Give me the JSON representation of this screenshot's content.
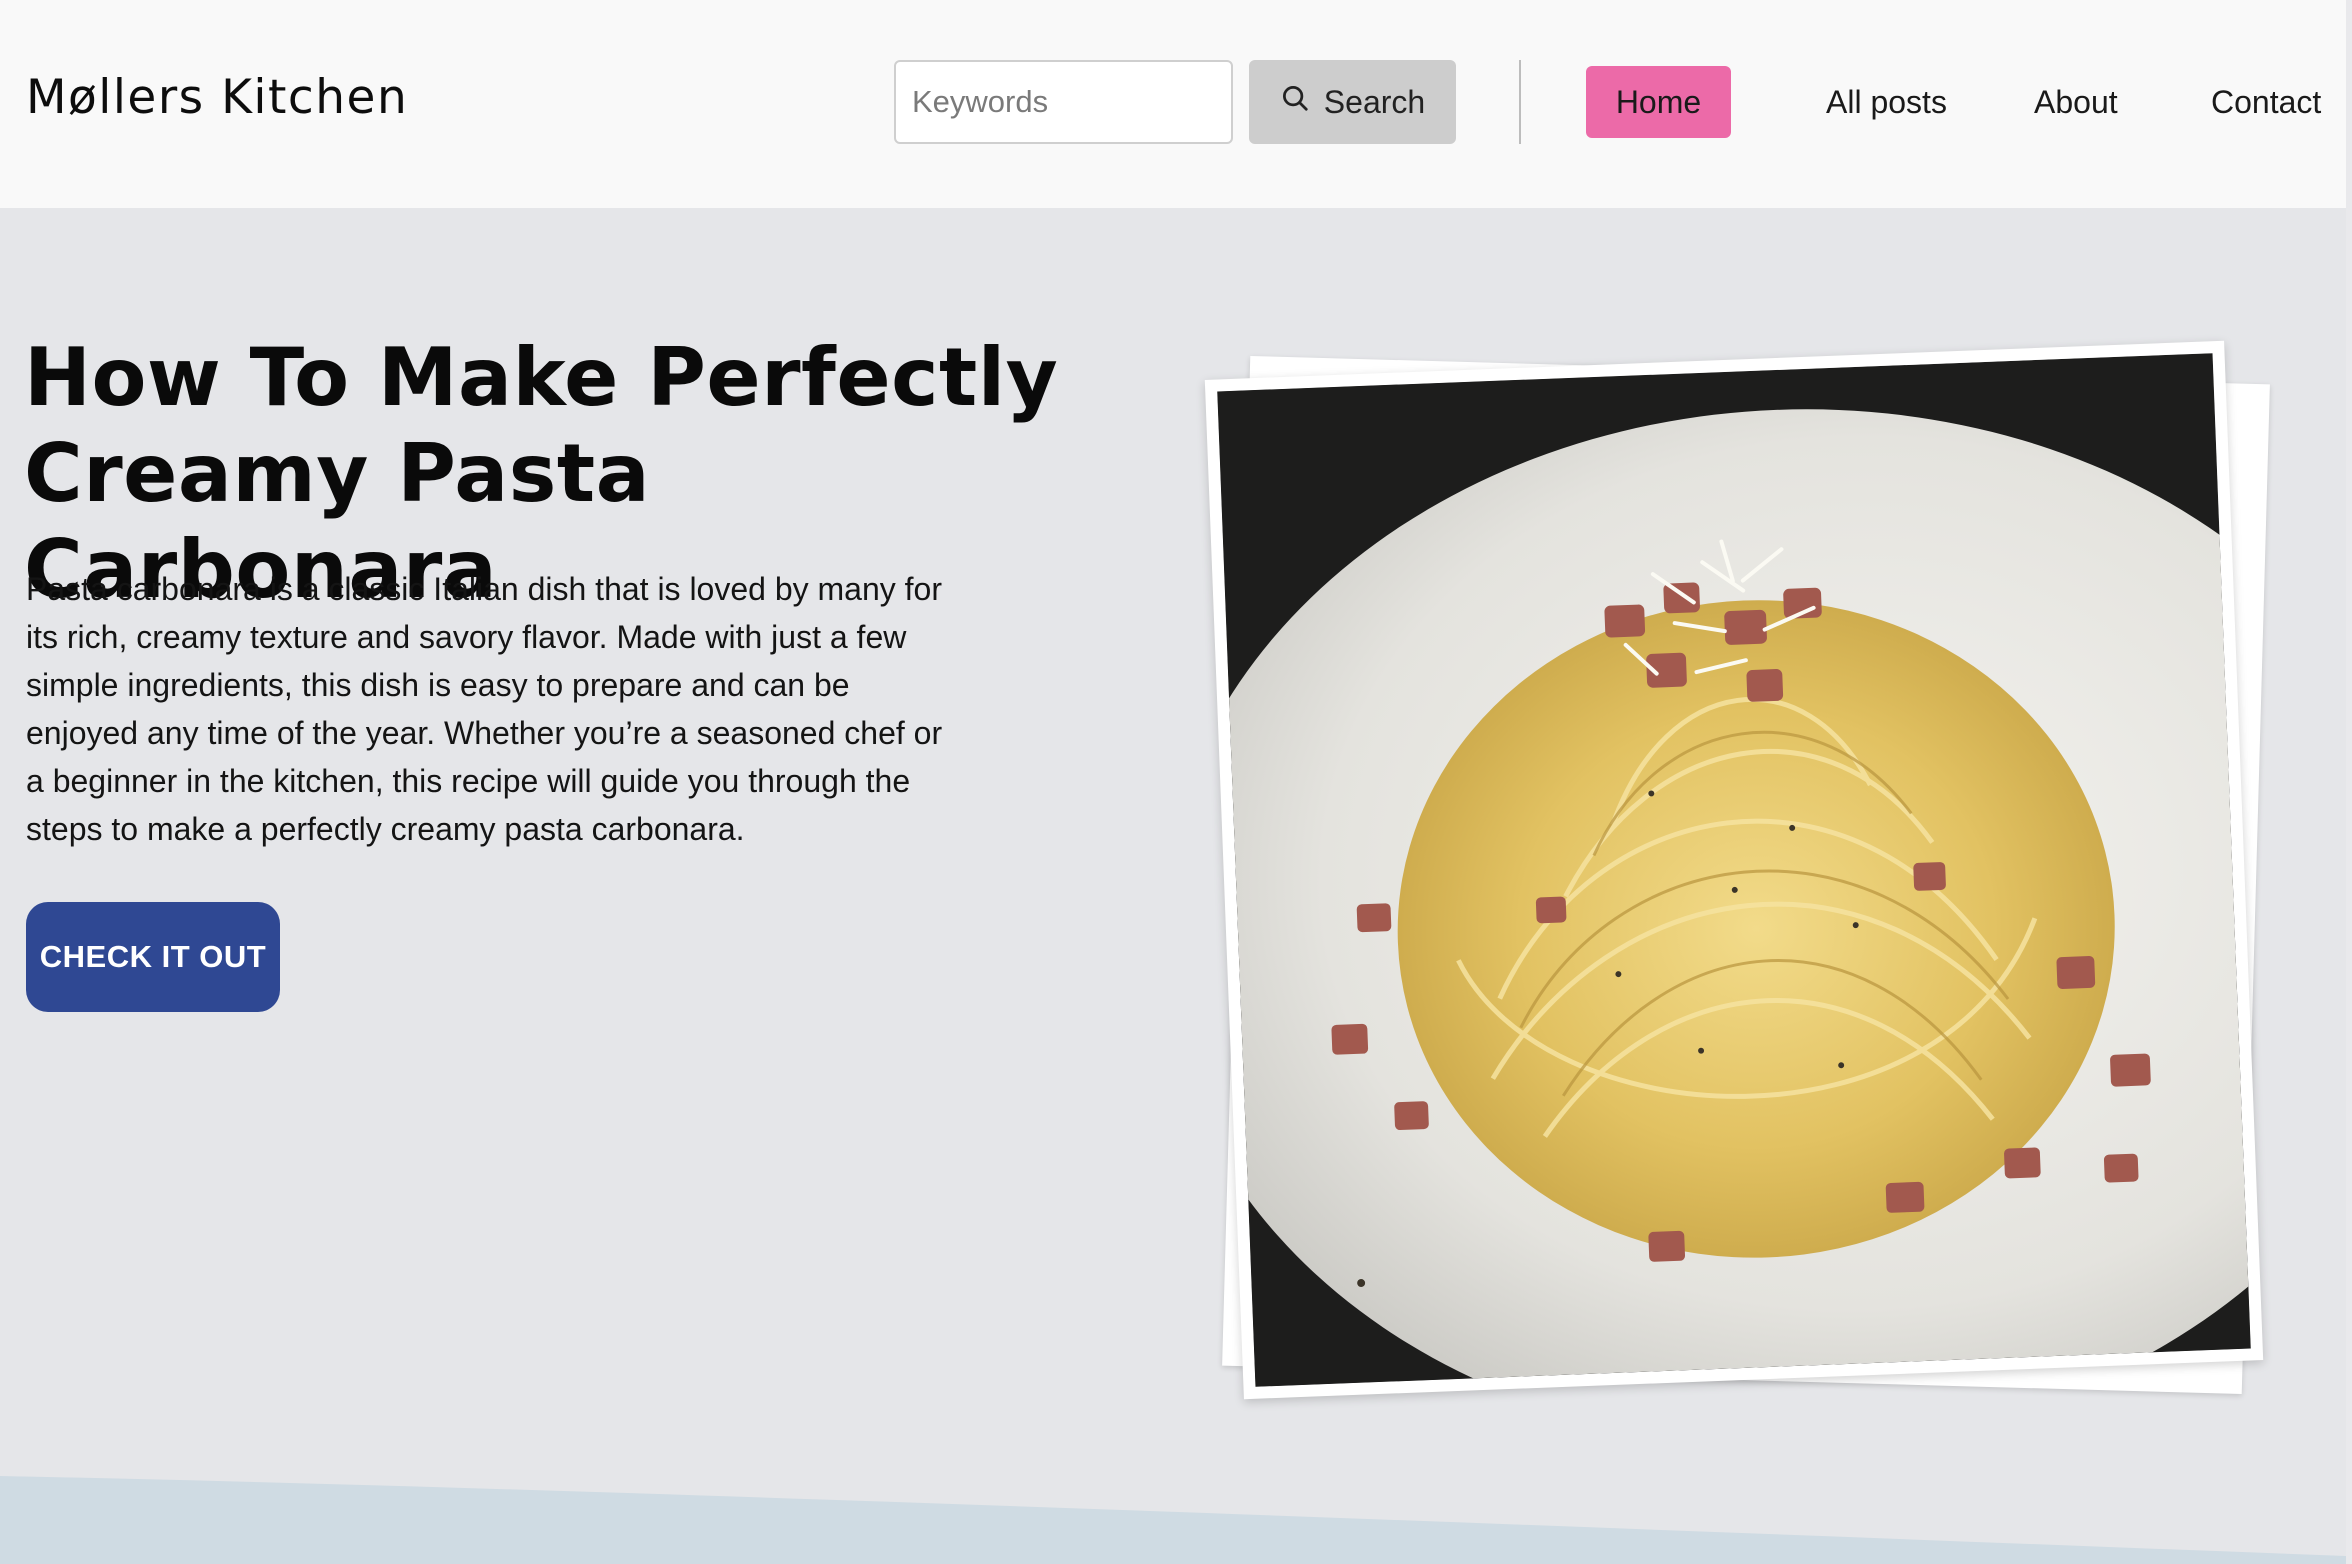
{
  "site": {
    "logo": "Møllers Kitchen"
  },
  "search": {
    "placeholder": "Keywords",
    "button_label": "Search"
  },
  "nav": {
    "home": "Home",
    "all_posts": "All posts",
    "about": "About",
    "contact": "Contact",
    "active": "Home"
  },
  "hero": {
    "title": "How To Make Perfectly Creamy Pasta Carbonara",
    "description": "Pasta carbonara is a classic Italian dish that is loved by many for its rich, creamy texture and savory flavor. Made with just a few simple ingredients, this dish is easy to prepare and can be enjoyed any time of the year. Whether you’re a seasoned chef or a beginner in the kitchen, this recipe will guide you through the steps to make a perfectly creamy pasta carbonara.",
    "cta_label": "CHECK IT OUT"
  },
  "colors": {
    "header_bg": "#f9f9f9",
    "hero_bg": "#e5e6e9",
    "nav_active": "#ec6aa8",
    "cta_bg": "#2f4893",
    "search_button_bg": "#cdcdcd"
  },
  "icons": {
    "search": "search-icon"
  }
}
